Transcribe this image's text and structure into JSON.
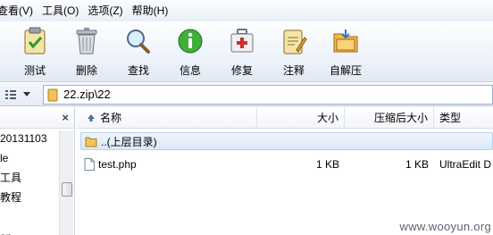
{
  "menu": [
    "查看(V)",
    "工具(O)",
    "选项(Z)",
    "帮助(H)"
  ],
  "toolbar": [
    {
      "label": "测试",
      "icon": "test-icon"
    },
    {
      "label": "删除",
      "icon": "trash-icon"
    },
    {
      "label": "查找",
      "icon": "magnifier-icon"
    },
    {
      "label": "信息",
      "icon": "info-icon"
    },
    {
      "label": "修复",
      "icon": "first-aid-icon"
    },
    {
      "label": "注释",
      "icon": "comment-icon"
    },
    {
      "label": "自解压",
      "icon": "sfx-icon"
    }
  ],
  "address": {
    "path": "22.zip\\22"
  },
  "tree": {
    "close": "×",
    "items": [
      "20131103",
      "le",
      "工具",
      "教程",
      "",
      "on"
    ]
  },
  "columns": {
    "name": "名称",
    "size": "大小",
    "packed": "压缩后大小",
    "type": "类型"
  },
  "rows": [
    {
      "name": "..(上层目录)",
      "size": "",
      "packed": "",
      "type": "",
      "kind": "parent"
    },
    {
      "name": "test.php",
      "size": "1 KB",
      "packed": "1 KB",
      "type": "UltraEdit D",
      "kind": "file"
    }
  ],
  "watermark": "www.wooyun.org"
}
